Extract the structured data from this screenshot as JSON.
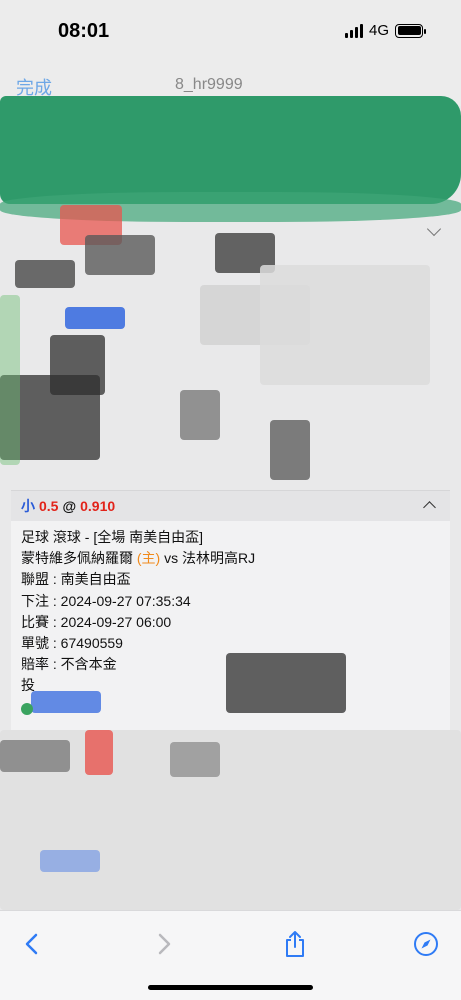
{
  "status": {
    "time": "08:01",
    "network": "4G"
  },
  "nav": {
    "done_label": "完成",
    "title": "8_hr9999"
  },
  "bet": {
    "side": "小",
    "line": "0.5",
    "at": "@",
    "odds": "0.910",
    "sport_market": "足球 滾球 - [全場 南美自由盃]",
    "home_team": "蒙特維多佩納羅爾",
    "home_tag": "(主)",
    "vs": "vs",
    "away_team": "法林明高RJ",
    "league": "聯盟 : 南美自由盃",
    "bet_time": "下注 : 2024-09-27 07:35:34",
    "match_time": "比賽 : 2024-09-27 06:00",
    "ticket": "單號 : 67490559",
    "odds_type": "賠率 : 不含本金",
    "stake_prefix": "投"
  },
  "colors": {
    "accent": "#2a5bd7",
    "highlight": "#e2231a",
    "home_tag": "#f08a1c",
    "link": "#2f7bf5",
    "scribble_green": "#2f9a6a"
  },
  "toolbar": {
    "icons": [
      "back-icon",
      "forward-icon",
      "share-icon",
      "compass-icon"
    ]
  }
}
